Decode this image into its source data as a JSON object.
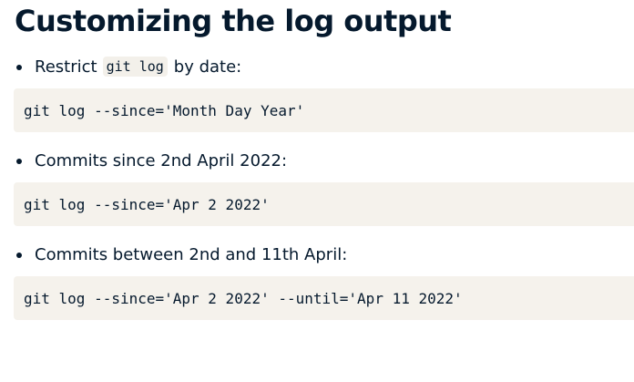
{
  "title": "Customizing the log output",
  "items": [
    {
      "text_before": "Restrict",
      "inline_code": "git log",
      "text_after": "by date:",
      "code": "git log --since='Month Day Year'"
    },
    {
      "text": "Commits since 2nd April 2022:",
      "code": "git log --since='Apr 2 2022'"
    },
    {
      "text": "Commits between 2nd and 11th April:",
      "code": "git log --since='Apr 2 2022' --until='Apr 11 2022'"
    }
  ]
}
